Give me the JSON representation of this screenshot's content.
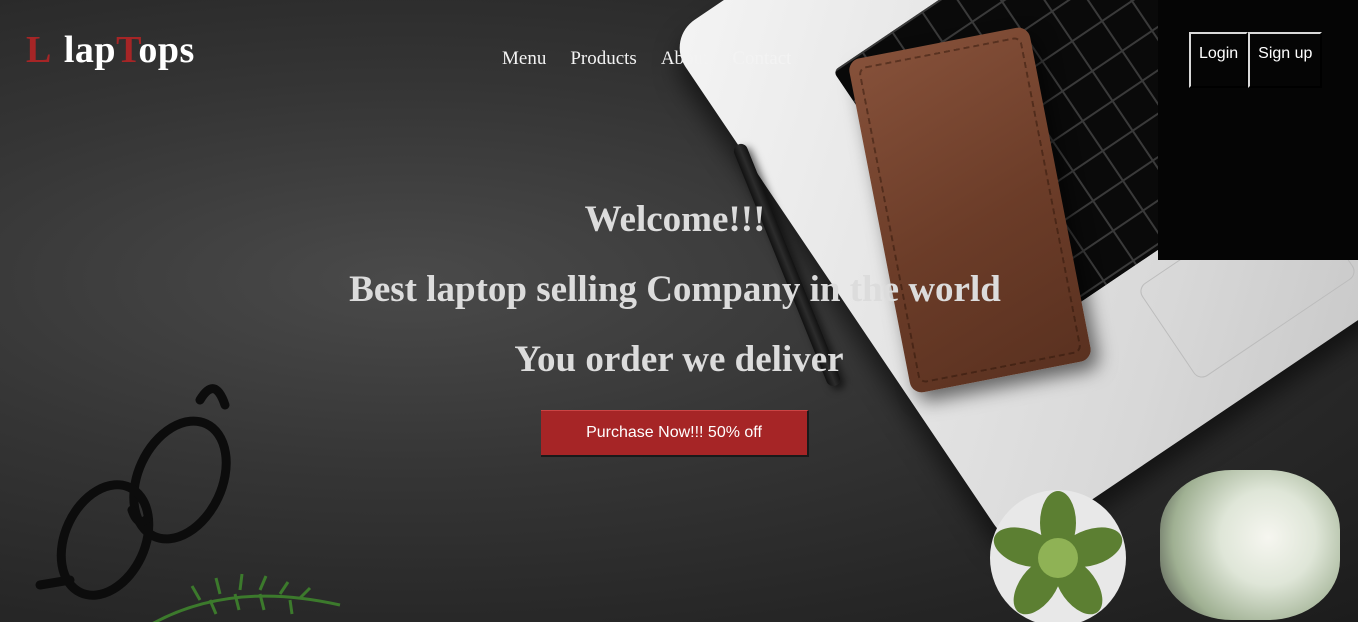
{
  "brand": {
    "first_letter": "L",
    "name_part1": "lap",
    "name_accent": "T",
    "name_part2": "ops",
    "accent_color": "#a62526"
  },
  "nav": {
    "items": [
      {
        "label": "Menu"
      },
      {
        "label": "Products"
      },
      {
        "label": "About"
      },
      {
        "label": "Contact"
      }
    ]
  },
  "auth": {
    "login_label": "Login",
    "signup_label": "Sign up"
  },
  "hero": {
    "line1": "Welcome!!!",
    "line2": "Best laptop selling Company in the world",
    "line3": "You order we deliver",
    "cta_label": "Purchase Now!!! 50% off",
    "cta_color": "#a62526"
  },
  "icons": [
    "laptop",
    "leather-wallet",
    "pen",
    "eyeglasses",
    "succulent-plant",
    "candle",
    "plant-sprig"
  ]
}
